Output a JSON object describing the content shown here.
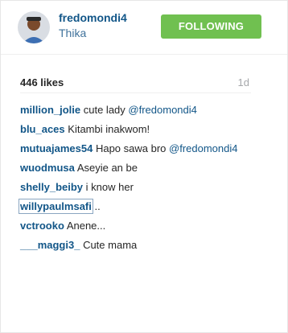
{
  "post": {
    "username": "fredomondi4",
    "location": "Thika",
    "follow_label": "FOLLOWING",
    "likes": "446 likes",
    "time": "1d"
  },
  "comments": [
    {
      "user": "million_jolie",
      "text": "cute lady ",
      "mention": "@fredomondi4"
    },
    {
      "user": "blu_aces",
      "text": "Kitambi inakwom!",
      "mention": ""
    },
    {
      "user": "mutuajames54",
      "text": "Hapo sawa bro ",
      "mention": "@fredomondi4"
    },
    {
      "user": "wuodmusa",
      "text": "Aseyie an be",
      "mention": ""
    },
    {
      "user": "shelly_beiby",
      "text": "i know her",
      "mention": ""
    },
    {
      "user": "willypaulmsafi",
      "text": "..",
      "mention": ""
    },
    {
      "user": "vctrooko",
      "text": "Anene...",
      "mention": ""
    },
    {
      "user": "___maggi3_",
      "text": "Cute mama",
      "mention": ""
    }
  ]
}
